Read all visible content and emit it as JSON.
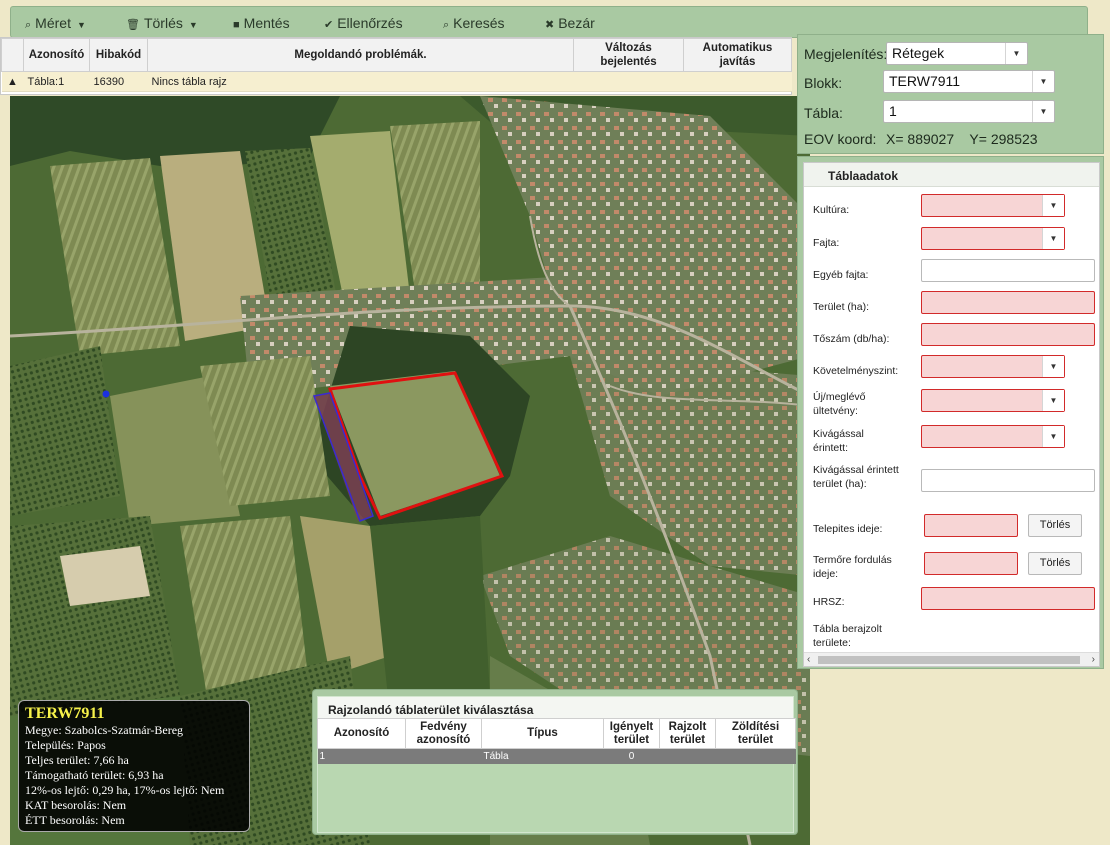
{
  "toolbar": {
    "items": [
      {
        "icon": "magnifier-icon",
        "label": "Méret",
        "has_dropdown": true
      },
      {
        "icon": "trash-icon",
        "label": "Törlés",
        "has_dropdown": true
      },
      {
        "icon": "save-icon",
        "label": "Mentés",
        "has_dropdown": false
      },
      {
        "icon": "check-icon",
        "label": "Ellenőrzés",
        "has_dropdown": false
      },
      {
        "icon": "search-icon",
        "label": "Keresés",
        "has_dropdown": false
      },
      {
        "icon": "close-icon",
        "label": "Bezár",
        "has_dropdown": false
      }
    ]
  },
  "errors": {
    "headers": [
      "Azonosító",
      "Hibakód",
      "Megoldandó problémák.",
      "Változás bejelentés",
      "Automatikus javítás"
    ],
    "rows": [
      {
        "id": "Tábla:1",
        "code": "16390",
        "problem": "Nincs tábla rajz",
        "change": "",
        "autofix": ""
      }
    ]
  },
  "view": {
    "display_label": "Megjelenítés:",
    "display_value": "Rétegek",
    "block_label": "Blokk:",
    "block_value": "TERW7911",
    "table_label": "Tábla:",
    "table_value": "1",
    "eov_label": "EOV koord:",
    "eov_value": "X= 889027    Y= 298523"
  },
  "tabla": {
    "title": "Táblaadatok",
    "fields": [
      {
        "label": "Kultúra:",
        "type": "select",
        "required": true
      },
      {
        "label": "Fajta:",
        "type": "select",
        "required": true
      },
      {
        "label": "Egyéb fajta:",
        "type": "text",
        "required": false
      },
      {
        "label": "Terület (ha):",
        "type": "text",
        "required": true
      },
      {
        "label": "Tőszám (db/ha):",
        "type": "text",
        "required": true
      },
      {
        "label": "Követelményszint:",
        "type": "select",
        "required": true
      },
      {
        "label": "Új/meglévő ültetvény:",
        "type": "select",
        "required": true
      },
      {
        "label": "Kivágással érintett:",
        "type": "select",
        "required": true
      },
      {
        "label": "Kivágással érintett terület (ha):",
        "type": "text",
        "required": false
      },
      {
        "label": "Telepites ideje:",
        "type": "date",
        "required": true,
        "button": "Törlés"
      },
      {
        "label": "Termőre fordulás ideje:",
        "type": "date",
        "required": true,
        "button": "Törlés"
      },
      {
        "label": "HRSZ:",
        "type": "text",
        "required": true
      },
      {
        "label": "Tábla berajzolt területe:",
        "type": "none",
        "required": false
      }
    ]
  },
  "info": {
    "title": "TERW7911",
    "lines": [
      "Megye: Szabolcs-Szatmár-Bereg",
      "Település: Papos",
      "Teljes terület: 7,66 ha",
      "Támogatható terület: 6,93 ha",
      "12%-os lejtő: 0,29 ha, 17%-os lejtő: Nem",
      "KAT besorolás: Nem",
      "ÉTT besorolás: Nem"
    ]
  },
  "selection": {
    "title": "Rajzolandó táblaterület kiválasztása",
    "headers": [
      "Azonosító",
      "Fedvény azonosító",
      "Típus",
      "Igényelt terület",
      "Rajzolt terület",
      "Zöldítési terület"
    ],
    "rows": [
      {
        "id": "1",
        "layer": "",
        "type": "Tábla",
        "requested": "0",
        "drawn": "",
        "greening": ""
      }
    ]
  },
  "colors": {
    "panel_green": "#a9c9a2",
    "required_fill": "#f7d5d5",
    "required_border": "#d22a2a",
    "parcel_outline": "#e01010",
    "parcel_highlight": "#3a2bd0"
  }
}
